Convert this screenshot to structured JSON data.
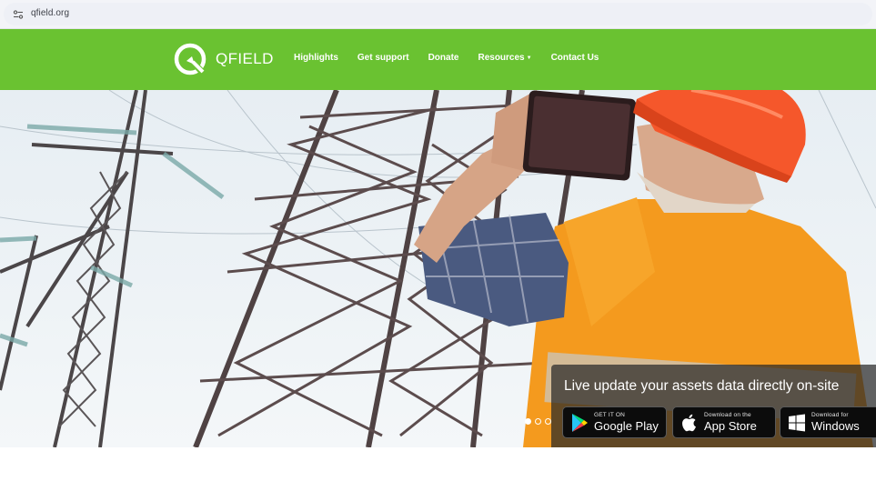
{
  "browser": {
    "url": "qfield.org"
  },
  "header": {
    "logo_text": "QFIELD",
    "nav": [
      {
        "label": "Highlights"
      },
      {
        "label": "Get support"
      },
      {
        "label": "Donate"
      },
      {
        "label": "Resources",
        "has_dropdown": true
      },
      {
        "label": "Contact Us"
      }
    ],
    "color": "#6ac231"
  },
  "hero": {
    "tagline": "Live update your assets data directly on-site",
    "stores": {
      "google_play": {
        "small": "GET IT ON",
        "big": "Google Play",
        "icon": "google-play-icon"
      },
      "app_store": {
        "small": "Download on the",
        "big": "App Store",
        "icon": "apple-icon"
      },
      "windows": {
        "small": "Download for",
        "big": "Windows",
        "icon": "windows-icon"
      }
    },
    "carousel": {
      "slides": 3,
      "active": 1
    }
  }
}
